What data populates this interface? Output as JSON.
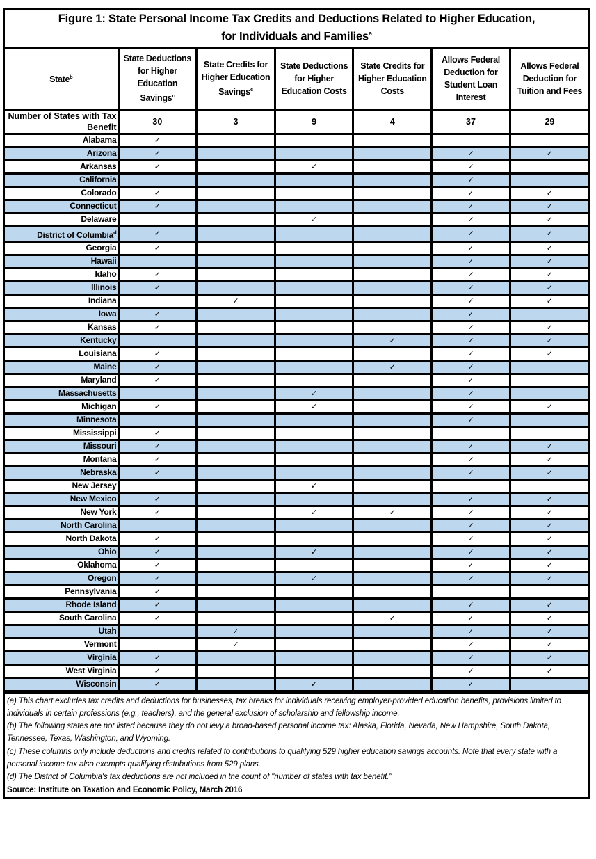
{
  "figure": {
    "title_line1": "Figure 1: State Personal Income Tax Credits and Deductions Related to Higher Education,",
    "title_line2": "for Individuals and Families",
    "title_sup": "a"
  },
  "table": {
    "headers": [
      {
        "label": "State",
        "sup": "b"
      },
      {
        "label": "State Deductions for Higher Education Savings",
        "sup": "c"
      },
      {
        "label": "State Credits for Higher Education Savings",
        "sup": "c"
      },
      {
        "label": "State Deductions for Higher Education Costs",
        "sup": ""
      },
      {
        "label": "State Credits for Higher Education Costs",
        "sup": ""
      },
      {
        "label": "Allows Federal Deduction for Student Loan Interest",
        "sup": ""
      },
      {
        "label": "Allows Federal Deduction for Tuition and Fees",
        "sup": ""
      }
    ],
    "count_row": {
      "label": "Number of States with Tax Benefit",
      "values": [
        "30",
        "3",
        "9",
        "4",
        "37",
        "29"
      ]
    },
    "check_glyph": "✓",
    "rows": [
      {
        "state": "Alabama",
        "sup": "",
        "checks": [
          1,
          0,
          0,
          0,
          0,
          0
        ]
      },
      {
        "state": "Arizona",
        "sup": "",
        "checks": [
          1,
          0,
          0,
          0,
          1,
          1
        ]
      },
      {
        "state": "Arkansas",
        "sup": "",
        "checks": [
          1,
          0,
          1,
          0,
          1,
          0
        ]
      },
      {
        "state": "California",
        "sup": "",
        "checks": [
          0,
          0,
          0,
          0,
          1,
          0
        ]
      },
      {
        "state": "Colorado",
        "sup": "",
        "checks": [
          1,
          0,
          0,
          0,
          1,
          1
        ]
      },
      {
        "state": "Connecticut",
        "sup": "",
        "checks": [
          1,
          0,
          0,
          0,
          1,
          1
        ]
      },
      {
        "state": "Delaware",
        "sup": "",
        "checks": [
          0,
          0,
          1,
          0,
          1,
          1
        ]
      },
      {
        "state": "District of Columbia",
        "sup": "d",
        "checks": [
          1,
          0,
          0,
          0,
          1,
          1
        ]
      },
      {
        "state": "Georgia",
        "sup": "",
        "checks": [
          1,
          0,
          0,
          0,
          1,
          1
        ]
      },
      {
        "state": "Hawaii",
        "sup": "",
        "checks": [
          0,
          0,
          0,
          0,
          1,
          1
        ]
      },
      {
        "state": "Idaho",
        "sup": "",
        "checks": [
          1,
          0,
          0,
          0,
          1,
          1
        ]
      },
      {
        "state": "Illinois",
        "sup": "",
        "checks": [
          1,
          0,
          0,
          0,
          1,
          1
        ]
      },
      {
        "state": "Indiana",
        "sup": "",
        "checks": [
          0,
          1,
          0,
          0,
          1,
          1
        ]
      },
      {
        "state": "Iowa",
        "sup": "",
        "checks": [
          1,
          0,
          0,
          0,
          1,
          0
        ]
      },
      {
        "state": "Kansas",
        "sup": "",
        "checks": [
          1,
          0,
          0,
          0,
          1,
          1
        ]
      },
      {
        "state": "Kentucky",
        "sup": "",
        "checks": [
          0,
          0,
          0,
          1,
          1,
          1
        ]
      },
      {
        "state": "Louisiana",
        "sup": "",
        "checks": [
          1,
          0,
          0,
          0,
          1,
          1
        ]
      },
      {
        "state": "Maine",
        "sup": "",
        "checks": [
          1,
          0,
          0,
          1,
          1,
          0
        ]
      },
      {
        "state": "Maryland",
        "sup": "",
        "checks": [
          1,
          0,
          0,
          0,
          1,
          0
        ]
      },
      {
        "state": "Massachusetts",
        "sup": "",
        "checks": [
          0,
          0,
          1,
          0,
          1,
          0
        ]
      },
      {
        "state": "Michigan",
        "sup": "",
        "checks": [
          1,
          0,
          1,
          0,
          1,
          1
        ]
      },
      {
        "state": "Minnesota",
        "sup": "",
        "checks": [
          0,
          0,
          0,
          0,
          1,
          0
        ]
      },
      {
        "state": "Mississippi",
        "sup": "",
        "checks": [
          1,
          0,
          0,
          0,
          0,
          0
        ]
      },
      {
        "state": "Missouri",
        "sup": "",
        "checks": [
          1,
          0,
          0,
          0,
          1,
          1
        ]
      },
      {
        "state": "Montana",
        "sup": "",
        "checks": [
          1,
          0,
          0,
          0,
          1,
          1
        ]
      },
      {
        "state": "Nebraska",
        "sup": "",
        "checks": [
          1,
          0,
          0,
          0,
          1,
          1
        ]
      },
      {
        "state": "New Jersey",
        "sup": "",
        "checks": [
          0,
          0,
          1,
          0,
          0,
          0
        ]
      },
      {
        "state": "New Mexico",
        "sup": "",
        "checks": [
          1,
          0,
          0,
          0,
          1,
          1
        ]
      },
      {
        "state": "New York",
        "sup": "",
        "checks": [
          1,
          0,
          1,
          1,
          1,
          1
        ]
      },
      {
        "state": "North Carolina",
        "sup": "",
        "checks": [
          0,
          0,
          0,
          0,
          1,
          1
        ]
      },
      {
        "state": "North Dakota",
        "sup": "",
        "checks": [
          1,
          0,
          0,
          0,
          1,
          1
        ]
      },
      {
        "state": "Ohio",
        "sup": "",
        "checks": [
          1,
          0,
          1,
          0,
          1,
          1
        ]
      },
      {
        "state": "Oklahoma",
        "sup": "",
        "checks": [
          1,
          0,
          0,
          0,
          1,
          1
        ]
      },
      {
        "state": "Oregon",
        "sup": "",
        "checks": [
          1,
          0,
          1,
          0,
          1,
          1
        ]
      },
      {
        "state": "Pennsylvania",
        "sup": "",
        "checks": [
          1,
          0,
          0,
          0,
          0,
          0
        ]
      },
      {
        "state": "Rhode Island",
        "sup": "",
        "checks": [
          1,
          0,
          0,
          0,
          1,
          1
        ]
      },
      {
        "state": "South Carolina",
        "sup": "",
        "checks": [
          1,
          0,
          0,
          1,
          1,
          1
        ]
      },
      {
        "state": "Utah",
        "sup": "",
        "checks": [
          0,
          1,
          0,
          0,
          1,
          1
        ]
      },
      {
        "state": "Vermont",
        "sup": "",
        "checks": [
          0,
          1,
          0,
          0,
          1,
          1
        ]
      },
      {
        "state": "Virginia",
        "sup": "",
        "checks": [
          1,
          0,
          0,
          0,
          1,
          1
        ]
      },
      {
        "state": "West Virginia",
        "sup": "",
        "checks": [
          1,
          0,
          0,
          0,
          1,
          1
        ]
      },
      {
        "state": "Wisconsin",
        "sup": "",
        "checks": [
          1,
          0,
          1,
          0,
          1,
          0
        ]
      }
    ]
  },
  "colors": {
    "alt_row": "#bdd7ee",
    "border": "#000000"
  },
  "notes": {
    "a": "(a) This chart excludes tax credits and deductions for businesses, tax breaks for individuals receiving employer-provided education benefits, provisions limited to individuals in certain professions (e.g., teachers), and the general exclusion of scholarship and fellowship income.",
    "b": "(b) The following states are not listed because they do not levy a broad-based personal income tax: Alaska, Florida, Nevada, New Hampshire, South Dakota, Tennessee, Texas, Washington, and Wyoming.",
    "c": "(c) These columns only include deductions and credits related to contributions to qualifying 529 higher education savings accounts.  Note that every state with a personal income tax also exempts qualifying distributions from 529 plans.",
    "d": "(d) The District of Columbia's tax deductions are not included in the count of \"number of states with tax benefit.\"",
    "source": "Source: Institute on Taxation and Economic Policy, March 2016"
  }
}
